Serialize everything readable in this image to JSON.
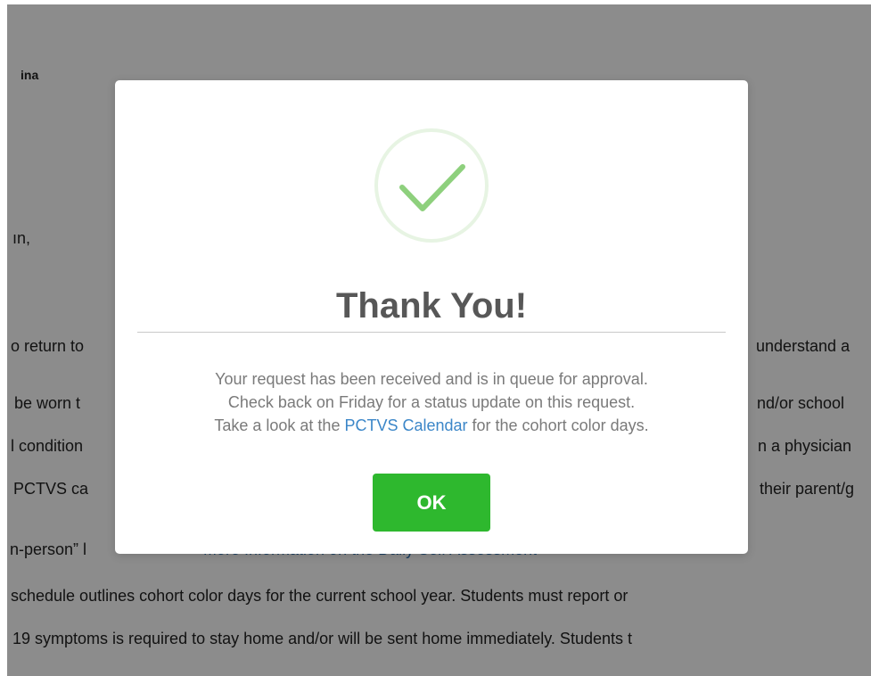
{
  "background": {
    "lines": [
      "ina",
      "ın,",
      "o return to",
      "understand a",
      "be worn t",
      "nd/or school",
      "l condition",
      "n a physician",
      "PCTVS ca",
      "their parent/g",
      "n-person” l",
      "More Information on the Daily Self Assessment",
      "schedule outlines cohort color days for the current school year. Students must report or",
      "19 symptoms is required to stay home and/or will be sent home immediately. Students t"
    ]
  },
  "modal": {
    "icon": "check-circle-icon",
    "title": "Thank You!",
    "body_line_1": "Your request has been received and is in queue for approval.",
    "body_line_2": "Check back on Friday for a status update on this request.",
    "body_line_3_prefix": "Take a look at the ",
    "body_line_3_link": "PCTVS Calendar",
    "body_line_3_suffix": " for the cohort color days.",
    "ok_label": "OK"
  },
  "colors": {
    "overlay": "rgba(0,0,0,0.45)",
    "success_green": "#2eb82e",
    "check_green": "#8ed07d",
    "link_blue": "#3b86c8",
    "title_gray": "#575757",
    "body_gray": "#7a7a7a"
  }
}
